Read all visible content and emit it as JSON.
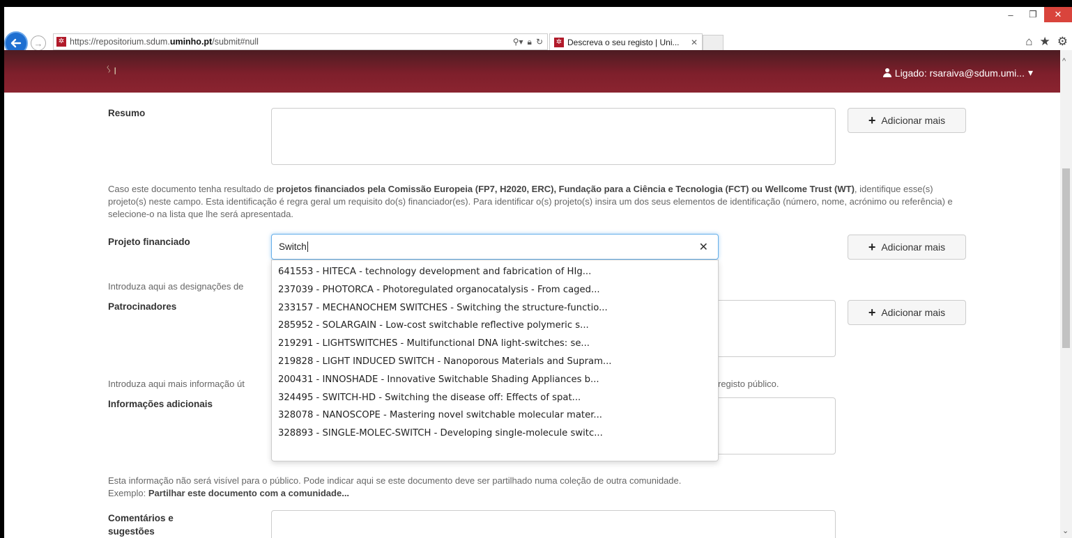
{
  "browser": {
    "url_prefix": "https://repositorium.sdum.",
    "url_domain": "uminho.pt",
    "url_suffix": "/submit#null",
    "tab_title": "Descreva o seu registo | Uni...",
    "favicon_glyph": "✲"
  },
  "header": {
    "logged_in_text": "Ligado: rsaraiva@sdum.umi...",
    "logo_text": "ᛊ ꞁ"
  },
  "form": {
    "resumo_label": "Resumo",
    "add_more_label": "Adicionar mais",
    "project_help_prefix": "Caso este documento tenha resultado de ",
    "project_help_bold1": "projetos financiados pela Comissão Europeia (FP7, H2020, ERC), Fundação para a Ciência e Tecnologia (FCT) ou Wellcome Trust (WT)",
    "project_help_rest": ", identifique esse(s) projeto(s) neste campo. Esta identificação é regra geral um requisito do(s) financiador(es). Para identificar o(s) projeto(s) insira um dos seus elementos de identificação (número, nome, acrónimo ou referência) e selecione-o na lista que lhe será apresentada.",
    "project_label": "Projeto financiado",
    "project_value": "Switch",
    "sponsors_help": "Introduza aqui as designações de",
    "sponsors_label": "Patrocinadores",
    "extra_help": "Introduza aqui mais informação út",
    "extra_help_tail": "registo público.",
    "extra_label": "Informações adicionais",
    "comments_help_line1": "Esta informação não será visível para o público. Pode indicar aqui se este documento deve ser partilhado numa coleção de outra comunidade.",
    "comments_help_example_prefix": "Exemplo: ",
    "comments_help_example_bold": "Partilhar este documento com a comunidade...",
    "comments_label_line1": "Comentários e",
    "comments_label_line2": "sugestões"
  },
  "dropdown_options": [
    "641553 - HITECA - technology development and fabrication of HIg...",
    "237039 - PHOTORCA - Photoregulated organocatalysis - From caged...",
    "233157 - MECHANOCHEM SWITCHES - Switching the structure-functio...",
    "285952 - SOLARGAIN - Low-cost switchable reflective polymeric s...",
    "219291 - LIGHTSWITCHES - Multifunctional DNA light-switches: se...",
    "219828 - LIGHT INDUCED SWITCH - Nanoporous Materials and Supram...",
    "200431 - INNOSHADE - Innovative Switchable Shading Appliances b...",
    "324495 - SWITCH-HD - Switching the disease off: Effects of spat...",
    "328078 - NANOSCOPE - Mastering novel switchable molecular mater...",
    "328893 - SINGLE-MOLEC-SWITCH - Developing single-molecule switc..."
  ],
  "colors": {
    "header_dark": "#4c1c22",
    "header_red": "#8b2430",
    "focus_blue": "#66afe9",
    "back_button_blue": "#1e6fd1"
  }
}
